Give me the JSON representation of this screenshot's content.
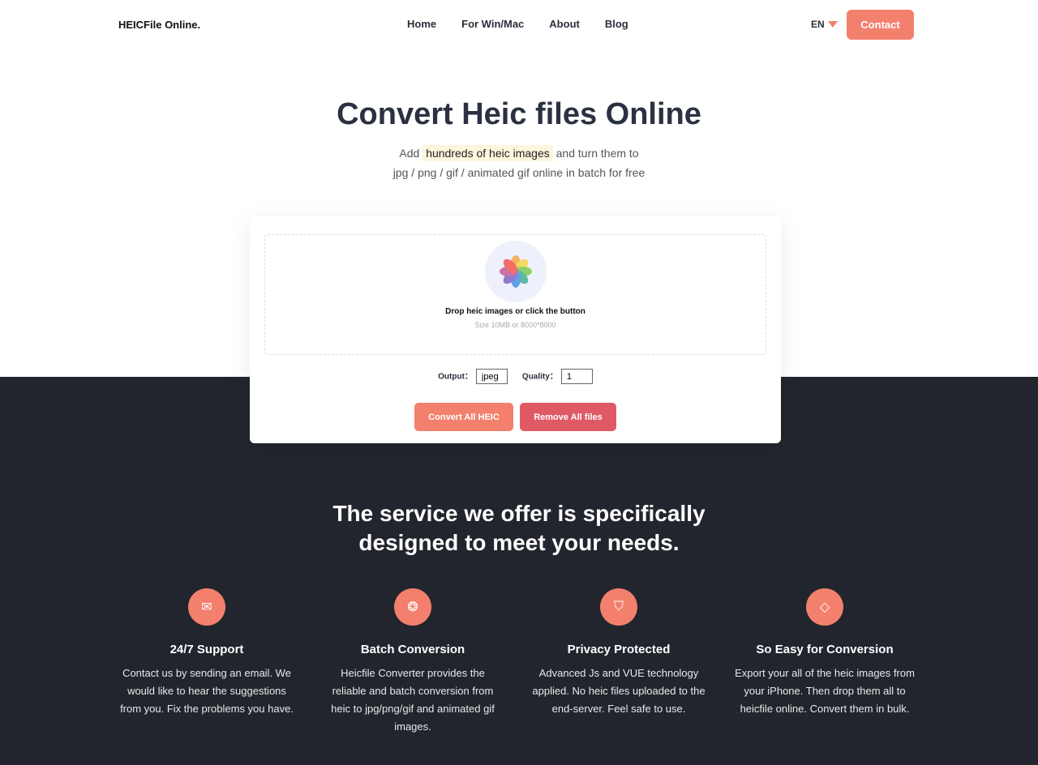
{
  "nav": {
    "logo": "HEICFile Online.",
    "links": [
      "Home",
      "For Win/Mac",
      "About",
      "Blog"
    ],
    "lang": "EN",
    "contact": "Contact"
  },
  "hero": {
    "title": "Convert Heic files Online",
    "sub_pre": "Add",
    "sub_highlight": "hundreds of heic images",
    "sub_post": "and turn them to",
    "sub_line2": "jpg / png / gif / animated gif online in batch for free"
  },
  "uploader": {
    "drop_text": "Drop heic images or click the button",
    "size_text": "Size 10MB or 8000*8000",
    "output_label": "Output：",
    "output_value": "jpeg",
    "quality_label": "Quality：",
    "quality_value": "1",
    "convert": "Convert All HEIC",
    "remove": "Remove All files"
  },
  "services": {
    "title_line1": "The service we offer is specifically",
    "title_line2": "designed to meet your needs.",
    "items": [
      {
        "icon": "mail-icon",
        "title": "24/7 Support",
        "desc": "Contact us by sending an email. We would like to hear the suggestions from you. Fix the problems you have."
      },
      {
        "icon": "aperture-icon",
        "title": "Batch Conversion",
        "desc": "Heicfile Converter provides the reliable and batch conversion from heic to jpg/png/gif and animated gif images."
      },
      {
        "icon": "shield-check-icon",
        "title": "Privacy Protected",
        "desc": "Advanced Js and VUE technology applied. No heic files uploaded to the end-server. Feel safe to use."
      },
      {
        "icon": "eraser-icon",
        "title": "So Easy for Conversion",
        "desc": "Export your all of the heic images from your iPhone. Then drop them all to heicfile online. Convert them in bulk."
      }
    ]
  },
  "colors": {
    "accent": "#f3806d",
    "danger": "#e05a66",
    "dark": "#22252d"
  }
}
